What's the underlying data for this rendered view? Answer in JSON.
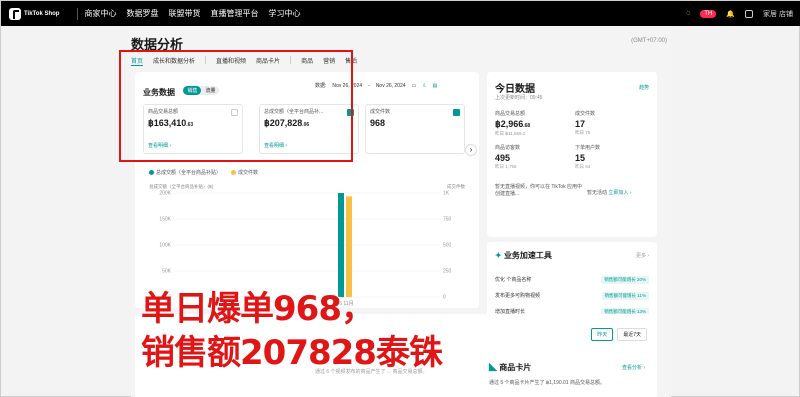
{
  "topbar": {
    "logo": "TikTok Shop",
    "nav": [
      "商家中心",
      "数据罗盘",
      "联盟带货",
      "直播管理平台",
      "学习中心"
    ],
    "badge": "TH",
    "shop": "家居 店铺"
  },
  "page": {
    "title": "数据分析",
    "timezone": "(GMT+07:00)",
    "tabs": [
      "首页",
      "成长和数据分析",
      "直播和视频",
      "商品卡片",
      "商品",
      "营销",
      "售后"
    ]
  },
  "business": {
    "title": "业务数据",
    "toggle": [
      "销售",
      "流量"
    ],
    "date_label": "数据:",
    "date_start": "Nov 26, 2024",
    "date_sep": "-",
    "date_end": "Nov 26, 2024",
    "metrics": [
      {
        "label": "商品交易总额",
        "value": "฿163,410",
        "decimal": ".63",
        "link": "查看明细 ›"
      },
      {
        "label": "总成交额（全平台商品补...",
        "value": "฿207,828",
        "decimal": ".06",
        "link": "查看明细 ›"
      },
      {
        "label": "成交件数",
        "value": "968",
        "decimal": "",
        "link": ""
      }
    ]
  },
  "chart": {
    "legend": [
      "总成交额（全平台商品补贴）",
      "成交件数"
    ],
    "ylabel_left": "总成交额（全平台商品补贴）(฿)",
    "ylabel_right": "成交件数",
    "yticks_left": [
      "200K",
      "150K",
      "100K",
      "50K",
      "0"
    ],
    "yticks_right": [
      "1K",
      "750",
      "500",
      "250",
      "0"
    ],
    "xtick": "26 11月"
  },
  "chart_data": {
    "type": "bar",
    "categories": [
      "26 11月"
    ],
    "series": [
      {
        "name": "总成交额（全平台商品补贴）",
        "values": [
          207828.06
        ],
        "color": "#009995"
      },
      {
        "name": "成交件数",
        "values": [
          968
        ],
        "color": "#f8c146"
      }
    ],
    "ylim_left": [
      0,
      200000
    ],
    "ylim_right": [
      0,
      1000
    ]
  },
  "today": {
    "title": "今日数据",
    "updated": "上次更新时间：09:45",
    "detail": "趋势",
    "metrics": [
      {
        "label": "商品交易总额",
        "value": "฿2,966",
        "decimal": ".68",
        "sub": "昨日 ฿11,569.2"
      },
      {
        "label": "成交件数",
        "value": "17",
        "decimal": "",
        "sub": "昨日 75"
      },
      {
        "label": "商品访客数",
        "value": "495",
        "decimal": "",
        "sub": "昨日 1,756"
      },
      {
        "label": "下单用户数",
        "value": "15",
        "decimal": "",
        "sub": "昨日 64"
      }
    ],
    "live_note": "暂无直播视频，你可以在 TikTok 应用中创建直播...",
    "live_note2": "暂无活动",
    "live_link": "立即加入 ›"
  },
  "speed": {
    "title": "业务加速工具",
    "more": "更多 ›",
    "rows": [
      {
        "label": "优化 个商品名称",
        "tag": "销售额可能增长 20%"
      },
      {
        "label": "发布更多可购物视频",
        "tag": "销售额可能增长 11%"
      },
      {
        "label": "增加直播时长",
        "tag": "销售额可能增长 13%"
      }
    ]
  },
  "bottom": {
    "tabs": [
      "昨天",
      "最近7天"
    ],
    "note": "通过 6 个视频发布的商品产生了 ... 商品交易总额。",
    "card_title": "商品卡片",
    "card_link": "查看分析 ›",
    "card_desc": "通过 5 个商品卡片产生了 ฿1,190.01 商品交易总额。"
  },
  "overlay": {
    "line1": "单日爆单968，",
    "line2": "销售额207828泰铢"
  },
  "colors": {
    "accent": "#009995",
    "highlight": "#e2140f",
    "overlay_text": "#e01616",
    "bar2": "#f8c146"
  }
}
